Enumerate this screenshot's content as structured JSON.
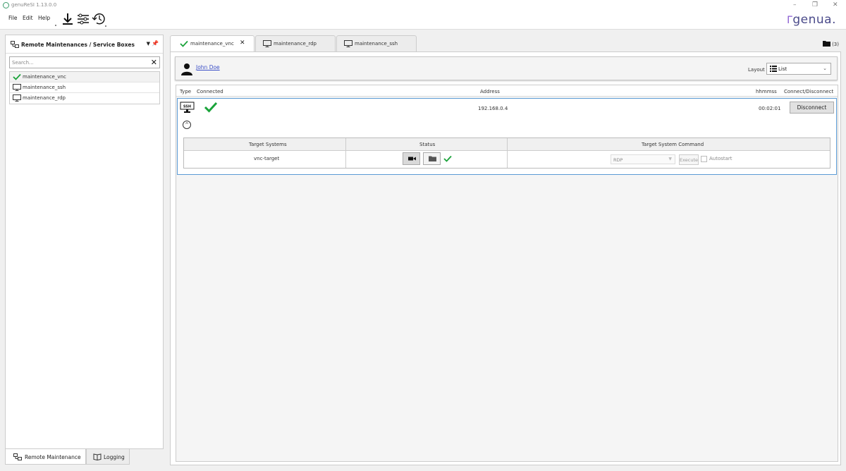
{
  "window": {
    "title": "genuReSI 1.13.0.0",
    "minimize": "–",
    "restore": "❐",
    "close": "✕"
  },
  "menu": [
    "File",
    "Edit",
    "Help"
  ],
  "toolbar": {
    "icons": [
      "download-icon",
      "settings-sliders-icon",
      "history-icon"
    ]
  },
  "logo": {
    "text": "genua."
  },
  "left_panel": {
    "title": "Remote Maintenances / Service Boxes",
    "search_placeholder": "Search...",
    "items": [
      {
        "label": "maintenance_vnc",
        "icon": "check-icon",
        "selected": true
      },
      {
        "label": "maintenance_ssh",
        "icon": "monitor-icon",
        "selected": false
      },
      {
        "label": "maintenance_rdp",
        "icon": "monitor-icon",
        "selected": false
      }
    ],
    "bottom_tabs": [
      {
        "label": "Remote Maintenance",
        "active": true
      },
      {
        "label": "Logging",
        "active": false
      }
    ]
  },
  "tabs": [
    {
      "label": "maintenance_vnc",
      "icon": "check-icon",
      "active": true
    },
    {
      "label": "maintenance_rdp",
      "icon": "monitor-icon",
      "active": false
    },
    {
      "label": "maintenance_ssh",
      "icon": "monitor-icon",
      "active": false
    }
  ],
  "folder_count": "(3)",
  "user": {
    "name": "John Doe"
  },
  "layout": {
    "label": "Layout",
    "value": "List"
  },
  "connections": {
    "headers": {
      "type": "Type",
      "connected": "Connected",
      "address": "Address",
      "time": "hhmmss",
      "action": "Connect/Disconnect"
    },
    "rows": [
      {
        "type": "SSH",
        "address": "192.168.0.4",
        "time": "00:02:01",
        "action_label": "Disconnect",
        "targets": {
          "headers": {
            "systems": "Target Systems",
            "status": "Status",
            "command": "Target System Command"
          },
          "rows": [
            {
              "system": "vnc-target",
              "command": "RDP",
              "execute": "Execute",
              "autostart": "Autostart"
            }
          ]
        }
      }
    ]
  },
  "colors": {
    "accent_check": "#1aa33a",
    "link": "#3b4fc7",
    "selection_border": "#5b9bd5"
  }
}
